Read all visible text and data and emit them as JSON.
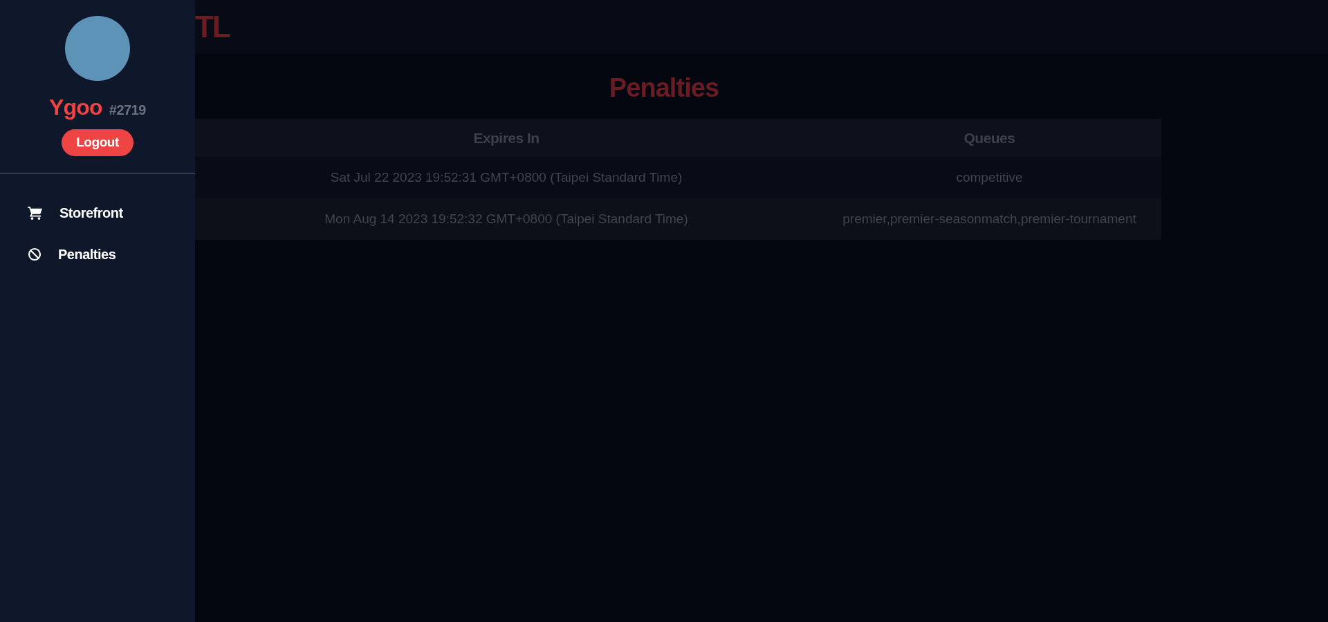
{
  "header": {
    "title": "TL"
  },
  "sidebar": {
    "username": "Ygoo",
    "tag": "#2719",
    "logout": "Logout",
    "items": [
      {
        "kind": "cart",
        "label": "Storefront"
      },
      {
        "kind": "ban",
        "label": "Penalties"
      }
    ]
  },
  "page": {
    "title": "Penalties",
    "table": {
      "columns": [
        "Expires In",
        "Queues"
      ],
      "rows": [
        [
          "Sat Jul 22 2023 19:52:31 GMT+0800 (Taipei Standard Time)",
          "competitive"
        ],
        [
          "Mon Aug 14 2023 19:52:32 GMT+0800 (Taipei Standard Time)",
          "premier,premier-seasonmatch,premier-tournament"
        ]
      ]
    }
  }
}
